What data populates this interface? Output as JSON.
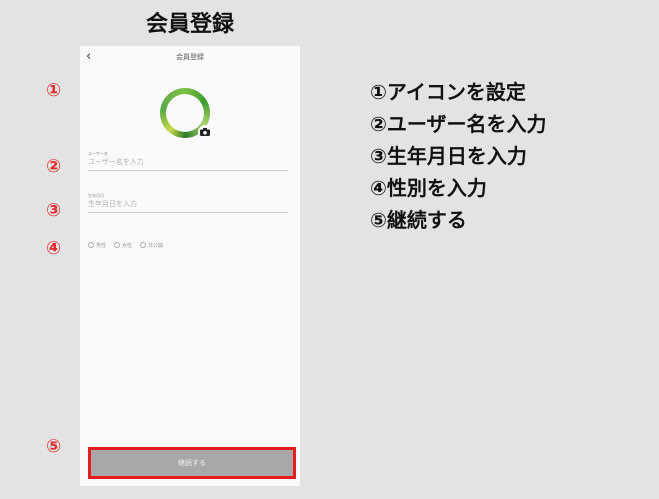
{
  "page_title": "会員登録",
  "screen": {
    "nav": {
      "back_icon": "‹",
      "title": "会員登録"
    },
    "avatar": {
      "icon": "avatar-ring",
      "camera_icon": "camera-icon"
    },
    "fields": {
      "username": {
        "label": "ユーザー名",
        "placeholder": "ユーザー名を入力"
      },
      "birthdate": {
        "label": "生年月日",
        "placeholder": "生年月日を入力"
      }
    },
    "gender_options": [
      "男性",
      "女性",
      "非公開"
    ],
    "continue_label": "継続する"
  },
  "markers": [
    "①",
    "②",
    "③",
    "④",
    "⑤"
  ],
  "steps": [
    "①アイコンを設定",
    "②ユーザー名を入力",
    "③生年月日を入力",
    "④性別を入力",
    "⑤継続する"
  ],
  "colors": {
    "annotation_red": "#e21d1d",
    "button_gray": "#a8a8a8",
    "background": "#e3e3e3"
  }
}
